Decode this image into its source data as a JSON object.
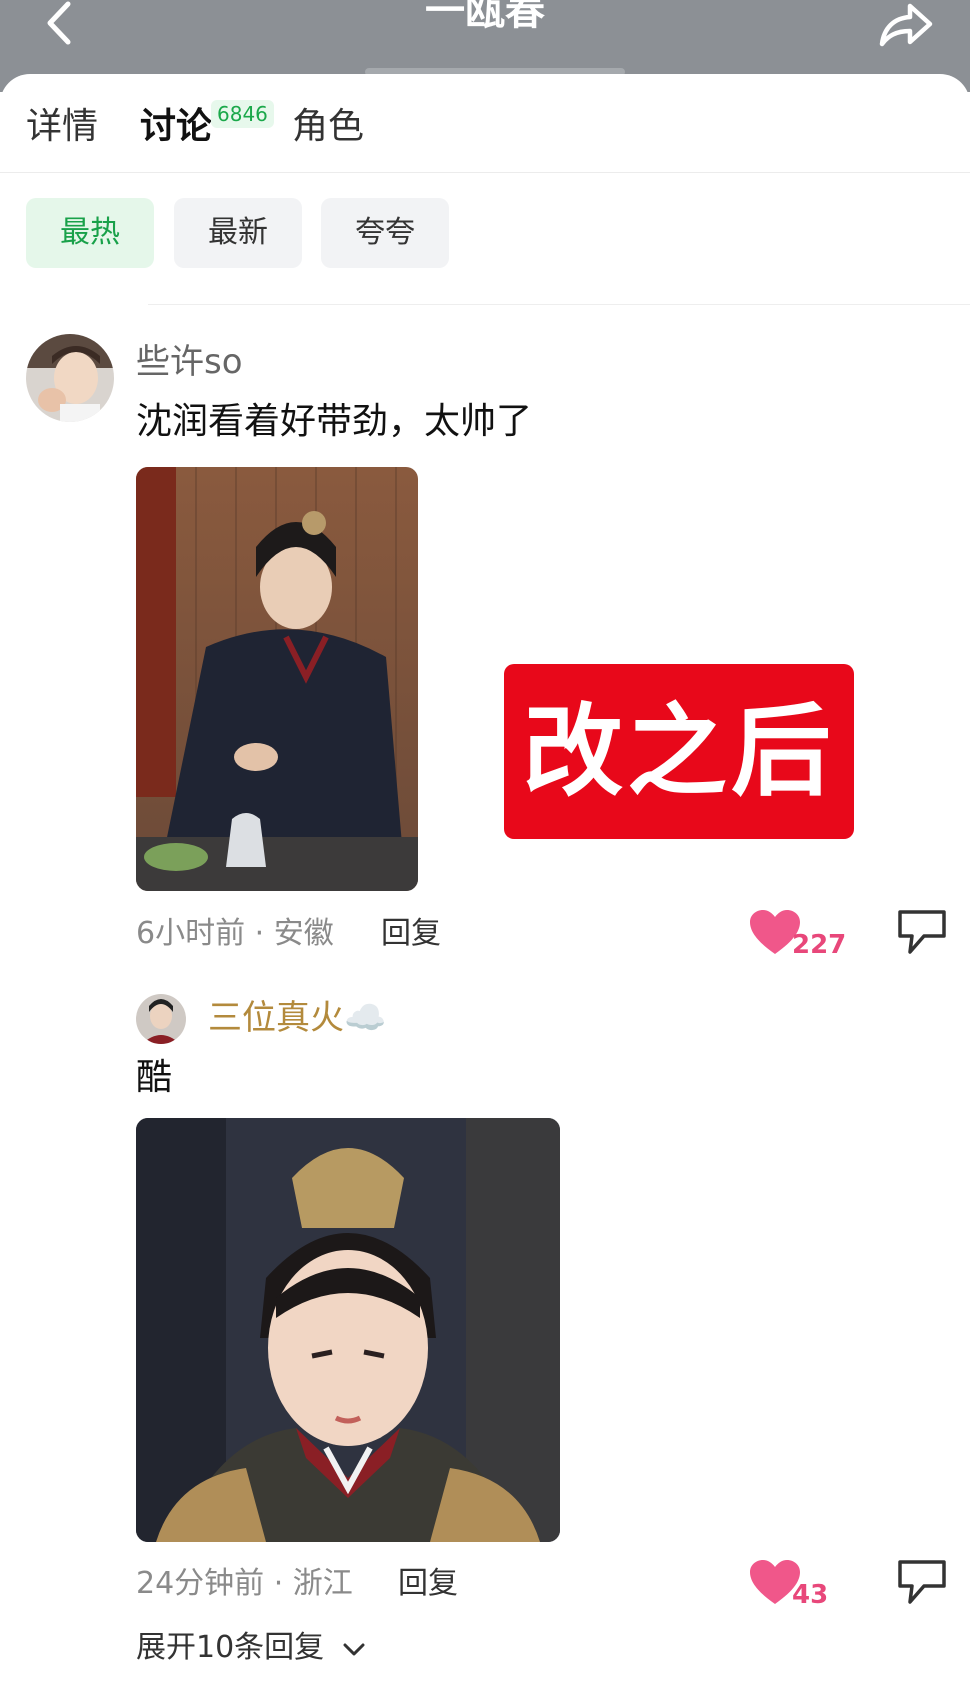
{
  "header": {
    "title": "一瓯春",
    "back_glyph": "‹"
  },
  "tabs": [
    {
      "label": "详情"
    },
    {
      "label": "讨论",
      "count": "6846"
    },
    {
      "label": "角色"
    }
  ],
  "filters": [
    {
      "label": "最热"
    },
    {
      "label": "最新"
    },
    {
      "label": "夸夸"
    }
  ],
  "comments": [
    {
      "user": "些许so",
      "text": "沈润看着好带劲，太帅了",
      "meta": "6小时前 · 安徽",
      "reply_label": "回复",
      "likes": "227",
      "overlay_label": "改之后"
    },
    {
      "user": "三位真火☁️",
      "text": "酷",
      "meta": "24分钟前 · 浙江",
      "reply_label": "回复",
      "likes": "43"
    }
  ],
  "expand_label": "展开10条回复",
  "colors": {
    "accent_green": "#19a14a",
    "like_pink": "#e8477a",
    "label_red": "#e8081a",
    "username_gold": "#b38a3c"
  }
}
